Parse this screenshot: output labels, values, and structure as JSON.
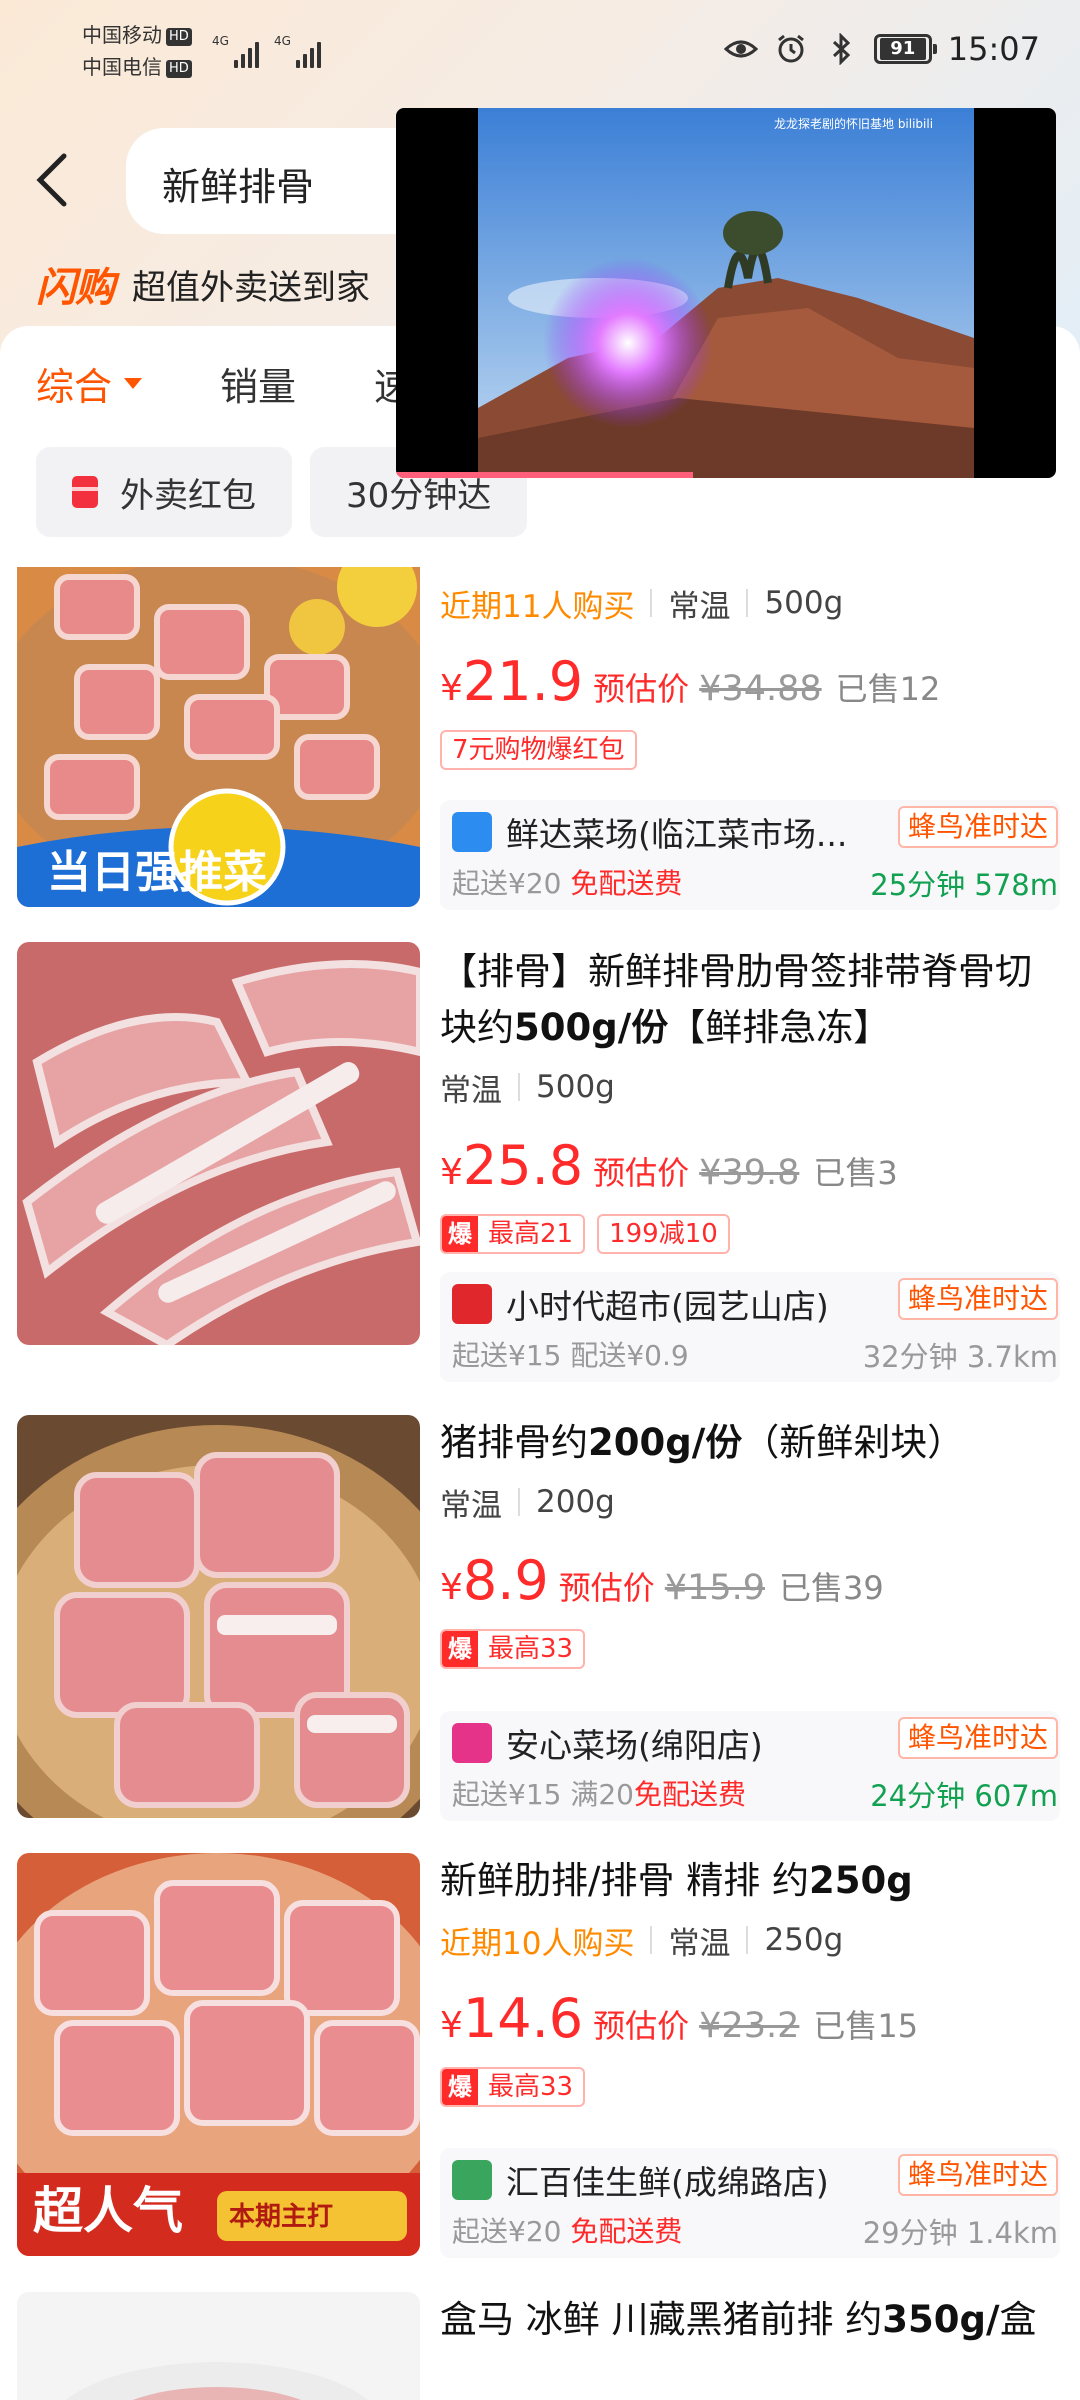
{
  "status_bar": {
    "carrier1": "中国移动",
    "carrier2": "中国电信",
    "hd": "HD",
    "net": "4G",
    "battery": "91",
    "time": "15:07"
  },
  "search": {
    "query": "新鲜排骨"
  },
  "banner": {
    "logo": "闪购",
    "text": "超值外卖送到家"
  },
  "sort_tabs": [
    "综合",
    "销量",
    "速度"
  ],
  "filters": [
    "外卖红包",
    "30分钟达"
  ],
  "pip": {
    "watermark": "龙龙探老剧的怀旧基地 bilibili",
    "progress": 0.45
  },
  "products": [
    {
      "title_parts": [],
      "buyers": "近期11人购买",
      "storage": "常温",
      "weight": "500g",
      "currency": "¥",
      "price": "21.9",
      "est_label": "预估价",
      "orig_price": "¥34.88",
      "sold": "已售12",
      "badges": [
        {
          "hot": "",
          "text": "7元购物爆红包"
        }
      ],
      "store": "鲜达菜场(临江菜市场...",
      "delivery_tag": "蜂鸟准时达",
      "min_order": "起送¥20",
      "fee": "免配送费",
      "eta": "25分钟 578m",
      "eta_green": true
    },
    {
      "title_parts": [
        "【排骨】新鲜排骨肋骨签排带脊骨切块约",
        "500g/份",
        "【鲜排急冻】"
      ],
      "buyers": "",
      "storage": "常温",
      "weight": "500g",
      "currency": "¥",
      "price": "25.8",
      "est_label": "预估价",
      "orig_price": "¥39.8",
      "sold": "已售3",
      "badges": [
        {
          "hot": "爆",
          "text": "最高21"
        },
        {
          "hot": "",
          "text": "199减10"
        }
      ],
      "store": "小时代超市(园艺山店)",
      "delivery_tag": "蜂鸟准时达",
      "min_order": "起送¥15 配送¥0.9",
      "fee": "",
      "eta": "32分钟 3.7km",
      "eta_green": false
    },
    {
      "title_parts": [
        "猪排骨约",
        "200g/份",
        "（新鲜剁块）"
      ],
      "buyers": "",
      "storage": "常温",
      "weight": "200g",
      "currency": "¥",
      "price": "8.9",
      "est_label": "预估价",
      "orig_price": "¥15.9",
      "sold": "已售39",
      "badges": [
        {
          "hot": "爆",
          "text": "最高33"
        }
      ],
      "store": "安心菜场(绵阳店)",
      "delivery_tag": "蜂鸟准时达",
      "min_order": "起送¥15 满20",
      "fee": "免配送费",
      "eta": "24分钟 607m",
      "eta_green": true
    },
    {
      "title_parts": [
        "新鲜肋排/排骨 精排 约",
        "250g",
        ""
      ],
      "buyers": "近期10人购买",
      "storage": "常温",
      "weight": "250g",
      "currency": "¥",
      "price": "14.6",
      "est_label": "预估价",
      "orig_price": "¥23.2",
      "sold": "已售15",
      "badges": [
        {
          "hot": "爆",
          "text": "最高33"
        }
      ],
      "store": "汇百佳生鲜(成绵路店)",
      "delivery_tag": "蜂鸟准时达",
      "min_order": "起送¥20",
      "fee": "免配送费",
      "eta": "29分钟 1.4km",
      "eta_green": false
    },
    {
      "title_parts": [
        "盒马 冰鲜 川藏黑猪前排 约",
        "350g/",
        "盒"
      ]
    }
  ],
  "image_text": {
    "p1_banner": "当日强推菜",
    "p4_banner": "超人气",
    "p4_sub": "本期主打"
  },
  "colors": {
    "accent": "#ff5500",
    "price": "#ff2b2b",
    "eta_green": "#12a150"
  }
}
